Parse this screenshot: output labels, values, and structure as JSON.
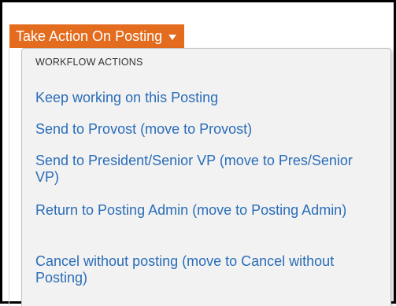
{
  "action_button": {
    "label": "Take Action On Posting"
  },
  "dropdown": {
    "section_header": "WORKFLOW ACTIONS",
    "items": [
      {
        "label": "Keep working on this Posting"
      },
      {
        "label": "Send to Provost (move to Provost)"
      },
      {
        "label": "Send to President/Senior VP (move to Pres/Senior VP)"
      },
      {
        "label": "Return to Posting Admin (move to Posting Admin)"
      },
      {
        "label": "Cancel without posting (move to Cancel without Posting)"
      }
    ]
  },
  "colors": {
    "button_bg": "#e36c1e",
    "link": "#2a6db8",
    "menu_bg": "#f2f2f2"
  }
}
